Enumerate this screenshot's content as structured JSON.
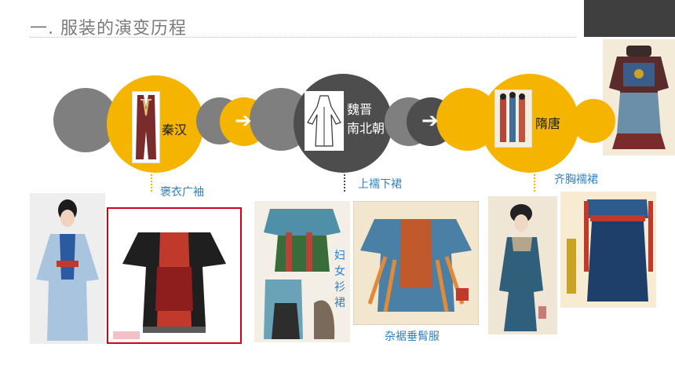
{
  "page": {
    "title": "一. 服装的演变历程"
  },
  "timeline": {
    "eras": [
      {
        "label": "秦汉"
      },
      {
        "label_line1": "魏晋",
        "label_line2": "南北朝"
      },
      {
        "label": "隋唐"
      }
    ],
    "arrows": [
      "➔",
      "➔"
    ]
  },
  "captions": {
    "qin_han": "褒衣广袖",
    "wei_jin": "上襦下裙",
    "sui_tang": "齐胸襦裙",
    "vertical": [
      "妇",
      "女",
      "衫",
      "裙"
    ],
    "zagui": "杂裾垂髾服"
  },
  "colors": {
    "yellow": "#f4b400",
    "grey": "#7f7f7f",
    "dark": "#4d4d4d",
    "caption_blue": "#2f7fc1"
  }
}
